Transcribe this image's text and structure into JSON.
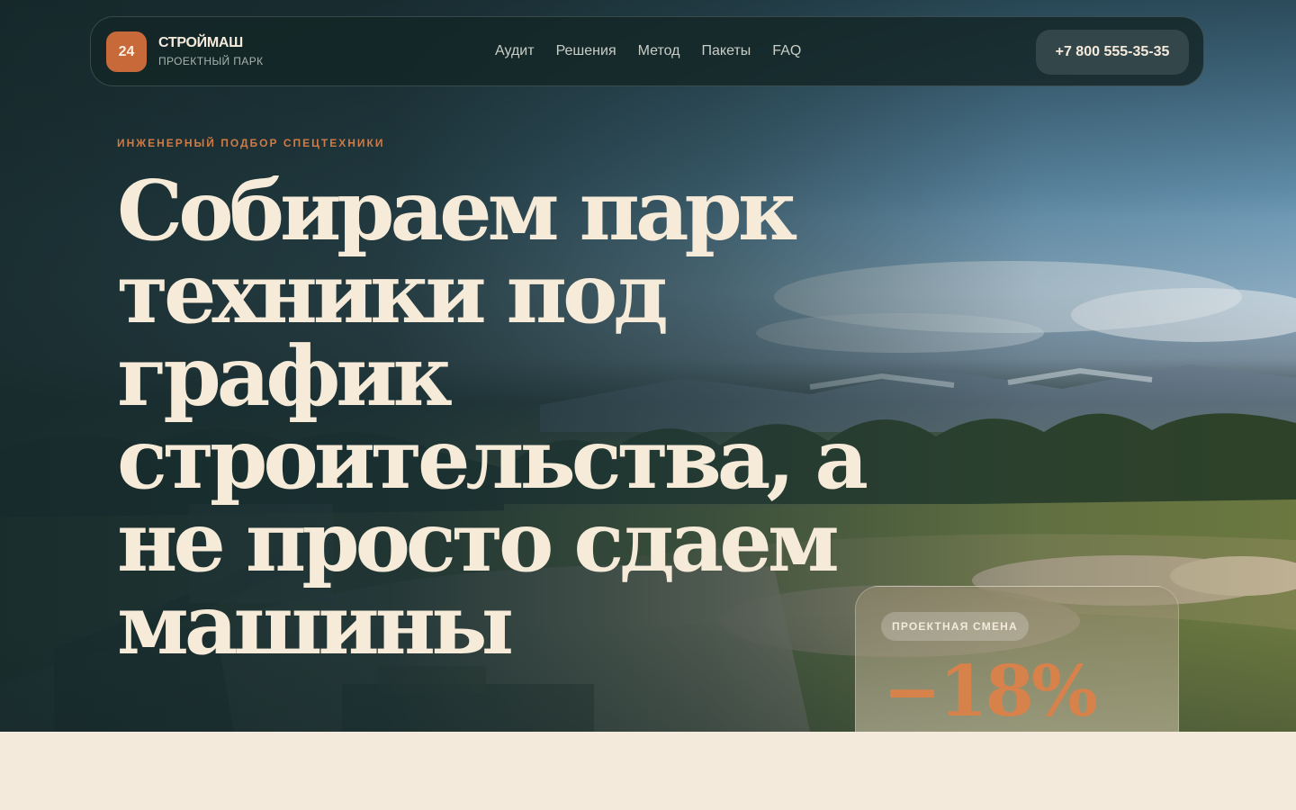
{
  "brand": {
    "badge": "24",
    "name": "СТРОЙМАШ",
    "subtitle": "ПРОЕКТНЫЙ ПАРК"
  },
  "nav": {
    "links": [
      "Аудит",
      "Решения",
      "Метод",
      "Пакеты",
      "FAQ"
    ],
    "phone": "+7 800 555-35-35"
  },
  "hero": {
    "eyebrow": "ИНЖЕНЕРНЫЙ ПОДБОР СПЕЦТЕХНИКИ",
    "headline": "Собираем парк техники под график строительства, а не просто сдаем машины"
  },
  "stat": {
    "chip": "ПРОЕКТНАЯ СМЕНА",
    "value": "−18%"
  },
  "colors": {
    "accent": "#c8693a",
    "cream": "#f6ead8",
    "dark": "#1b3233"
  }
}
